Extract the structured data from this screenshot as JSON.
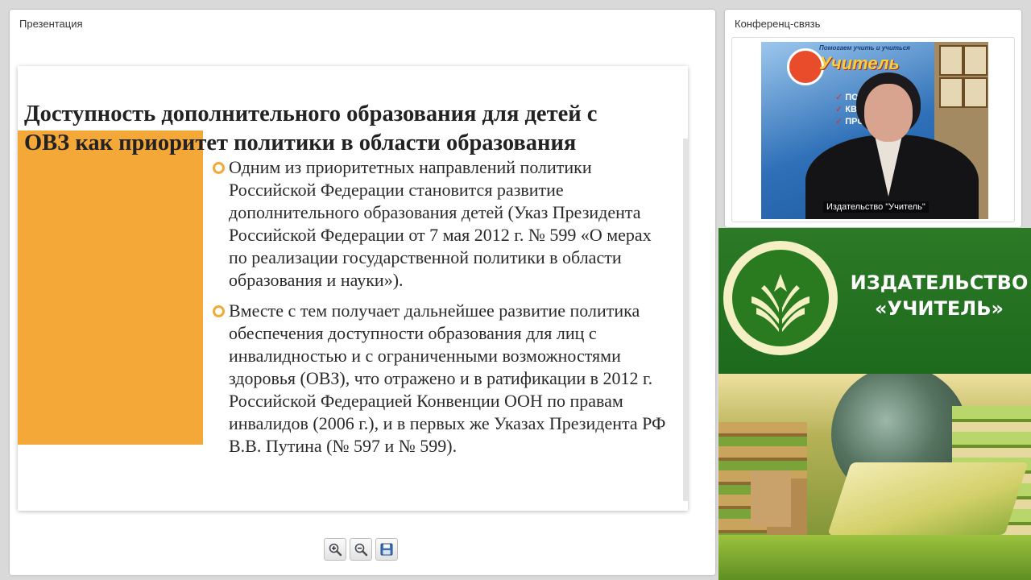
{
  "presentation": {
    "panel_title": "Презентация",
    "slide": {
      "title": "Доступность дополнительного образования  для детей с\nОВЗ как приоритет политики в области образования",
      "bullets": [
        "Одним из приоритетных направлений политики Российской Федерации становится развитие дополнительного  образования детей (Указ Президента Российской Федерации от 7 мая 2012 г. № 599 «О мерах по реализации государственной политики в области образования и науки»).",
        "Вместе с тем получает дальнейшее развитие политика обеспечения доступности образования для лиц с инвалидностью и с ограниченными возможностями здоровья (ОВЗ), что отражено и в ратификации в 2012 г. Российской Федерацией Конвенции ООН по правам инвалидов (2006 г.), и в первых же Указах Президента РФ В.В. Путина (№ 597 и № 599)."
      ]
    },
    "toolbar": {
      "zoom_in_icon": "zoom-in-icon",
      "zoom_out_icon": "zoom-out-icon",
      "save_icon": "save-icon"
    }
  },
  "conference": {
    "panel_title": "Конференц-связь",
    "video_caption": "Издательство \"Учитель\"",
    "poster": {
      "tagline": "Помогаем учить и учиться",
      "name": "Учитель"
    }
  },
  "banner": {
    "line1": "ИЗДАТЕЛЬСТВО",
    "line2": "«УЧИТЕЛЬ»"
  },
  "colors": {
    "slide_accent": "#f4a838",
    "banner_green": "#1d6a1d"
  }
}
